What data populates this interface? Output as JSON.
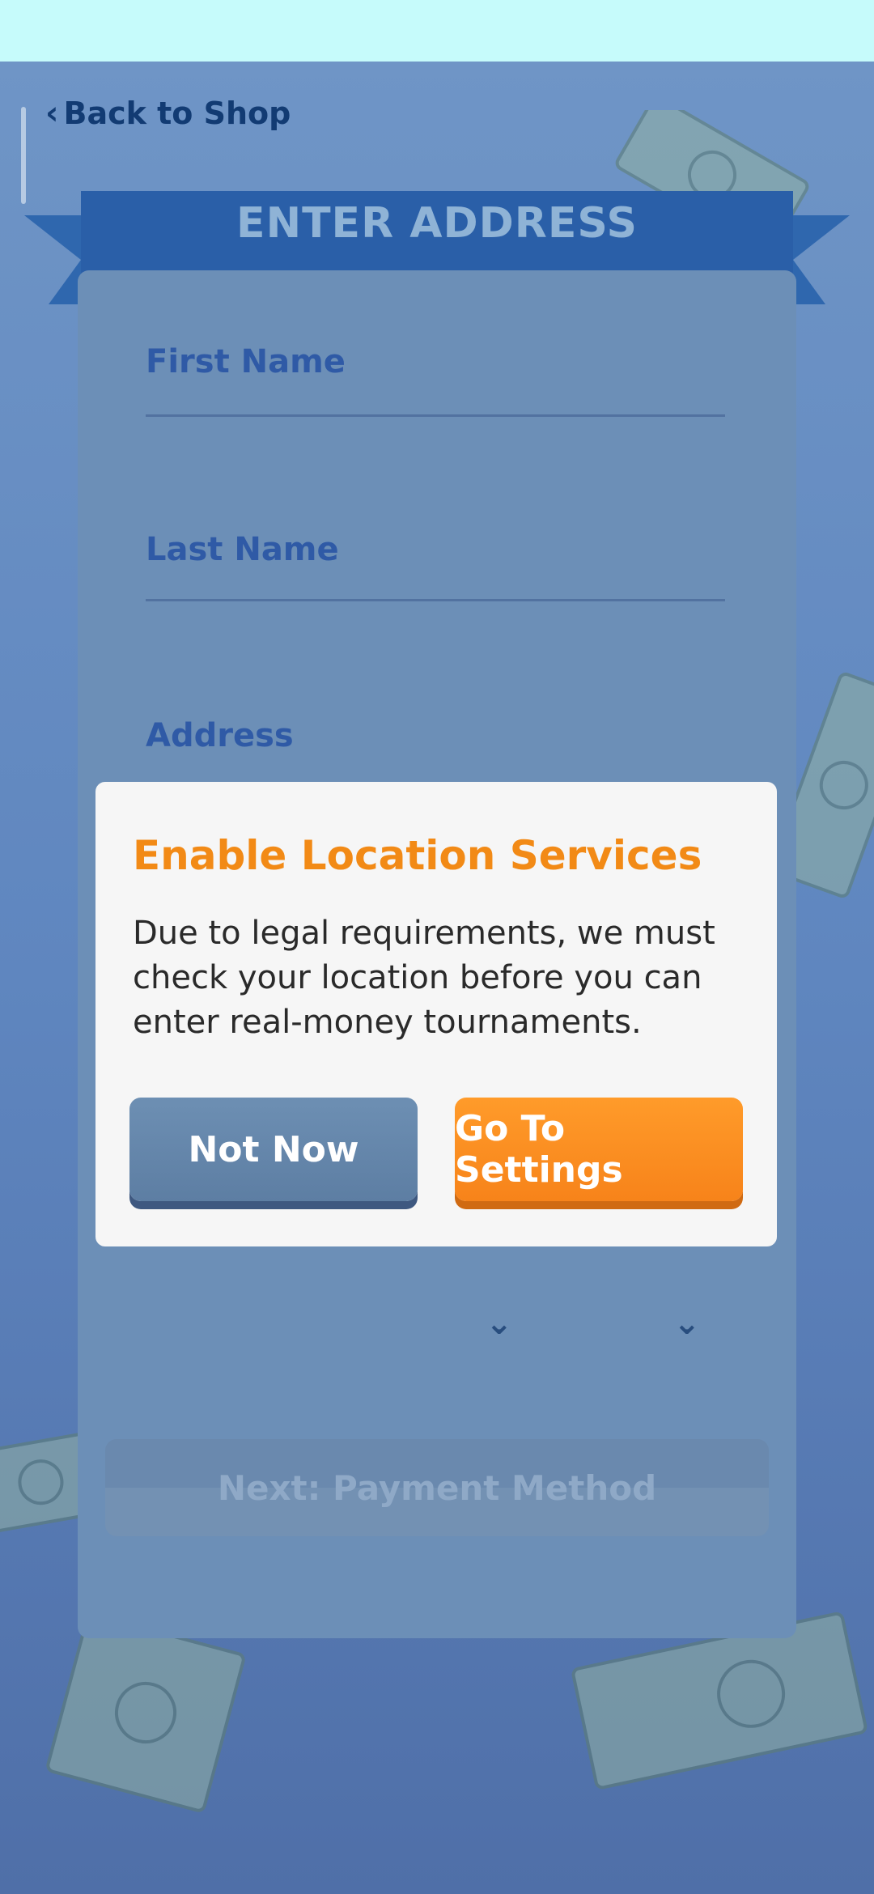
{
  "nav": {
    "back_label": "Back to Shop"
  },
  "form": {
    "title": "ENTER ADDRESS",
    "fields": [
      {
        "label": "First Name"
      },
      {
        "label": "Last Name"
      },
      {
        "label": "Address"
      }
    ],
    "next_button": "Next: Payment Method"
  },
  "dialog": {
    "title": "Enable Location Services",
    "body": "Due to legal requirements, we must check your location before you can enter real-money tournaments.",
    "not_now": "Not Now",
    "go_settings": "Go To Settings"
  },
  "colors": {
    "accent_orange": "#f7831a",
    "background_blue": "#5f86bf",
    "dialog_bg": "#f6f6f6",
    "title_orange": "#f28a16"
  },
  "icons": {
    "back": "chevron-left-icon",
    "dropdown": "chevron-down-icon"
  }
}
